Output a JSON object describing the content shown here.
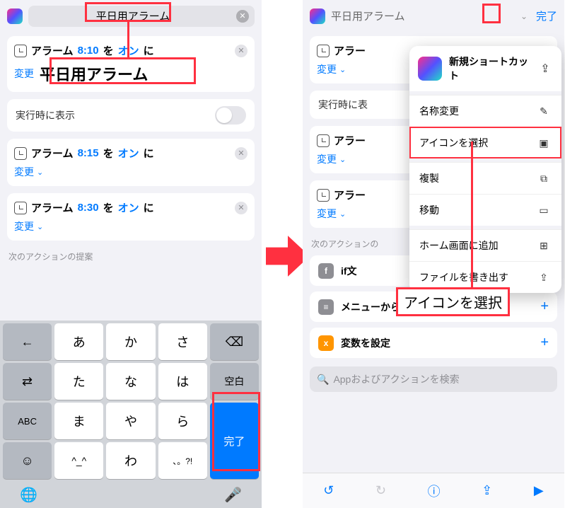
{
  "left": {
    "search_value": "平日用アラーム",
    "cards": [
      {
        "label": "アラーム",
        "time": "8:10",
        "w2": "を",
        "state": "オン",
        "w3": "に",
        "change": "変更",
        "name": "平日用アラーム"
      },
      {
        "label": "アラーム",
        "time": "8:15",
        "w2": "を",
        "state": "オン",
        "w3": "に",
        "change": "変更"
      },
      {
        "label": "アラーム",
        "time": "8:30",
        "w2": "を",
        "state": "オン",
        "w3": "に",
        "change": "変更"
      }
    ],
    "show_label": "実行時に表示",
    "hint": "次のアクションの提案",
    "keys": {
      "r1": [
        "あ",
        "か",
        "さ"
      ],
      "r2": [
        "た",
        "な",
        "は"
      ],
      "r3": [
        "ま",
        "や",
        "ら"
      ],
      "r4": [
        "^_^",
        "わ",
        "、。?!"
      ],
      "side": {
        "undo": "←",
        "rev": "⇄",
        "abc": "ABC",
        "emoji": "☺",
        "bksp": "⌫",
        "space": "空白",
        "done": "完了"
      }
    }
  },
  "right": {
    "title": "平日用アラーム",
    "done": "完了",
    "popover": {
      "title": "新規ショートカット",
      "rows": [
        {
          "t": "名称変更",
          "ic": "✎"
        },
        {
          "t": "アイコンを選択",
          "ic": "▣",
          "hl": true
        },
        {
          "t": "複製",
          "ic": "⧉"
        },
        {
          "t": "移動",
          "ic": "▭"
        },
        {
          "t": "ホーム画面に追加",
          "ic": "⊞"
        },
        {
          "t": "ファイルを書き出す",
          "ic": "⇪"
        }
      ]
    },
    "cards": [
      {
        "label": "アラー",
        "change": "変更"
      },
      {
        "label": "アラー",
        "change": "変更"
      },
      {
        "label": "アラー",
        "change": "変更"
      }
    ],
    "show_label": "実行時に表",
    "hint": "次のアクションの",
    "sugs": [
      {
        "t": "if文",
        "c": "#8e8e93"
      },
      {
        "t": "メニューから選択",
        "c": "#8e8e93"
      },
      {
        "t": "変数を設定",
        "c": "#ff9500"
      }
    ],
    "search_ph": "Appおよびアクションを検索",
    "callout": "アイコンを選択"
  }
}
